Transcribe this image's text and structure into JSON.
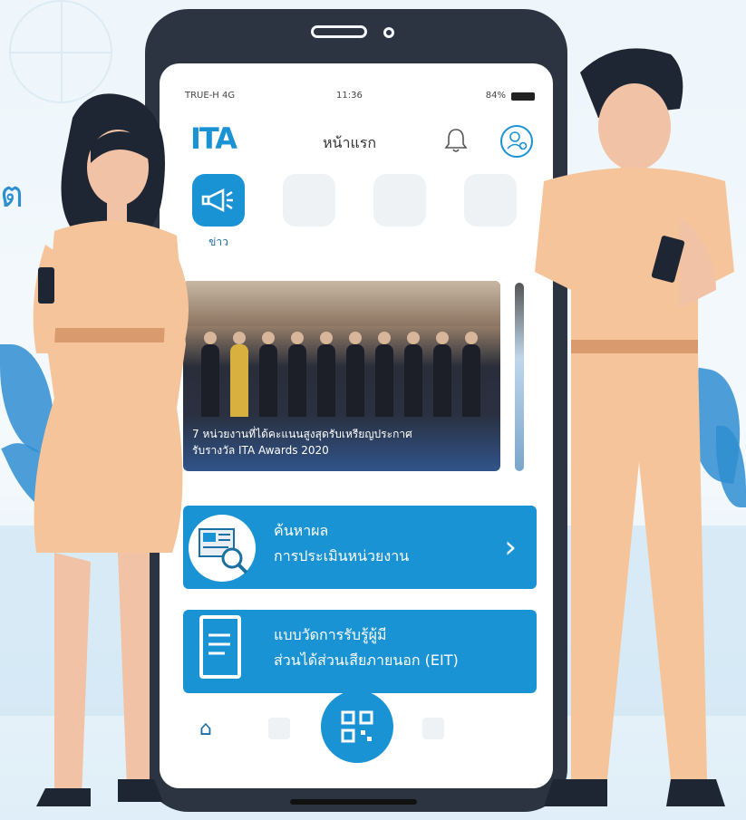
{
  "status": {
    "carrier": "TRUE-H  4G",
    "time": "11:36",
    "battery": "84%"
  },
  "app": {
    "logo": "ITA",
    "title": "หน้าแรก"
  },
  "menu": [
    {
      "label": "ข่าว",
      "icon": "megaphone-icon"
    },
    {
      "label": "",
      "icon": "chart-icon"
    },
    {
      "label": "",
      "icon": "document-icon"
    },
    {
      "label": "",
      "icon": "chat-icon"
    }
  ],
  "banner": {
    "small_text": "",
    "caption_line1": "7 หน่วยงานที่ได้คะแนนสูงสุดรับเหรียญประกาศ",
    "caption_line2": "รับรางวัล ITA Awards 2020"
  },
  "cards": [
    {
      "line1": "ค้นหาผล",
      "line2": "การประเมินหน่วยงาน",
      "icon": "search-document-icon"
    },
    {
      "line1": "แบบวัดการรับรู้ผู้มี",
      "line2": "ส่วนได้ส่วนเสียภายนอก (EIT)",
      "icon": "form-icon"
    }
  ],
  "tabbar": {
    "home_label": ""
  },
  "background_text": "ต",
  "colors": {
    "accent": "#1a93d4",
    "dark": "#2b3440",
    "uniform": "#f5c69c"
  }
}
